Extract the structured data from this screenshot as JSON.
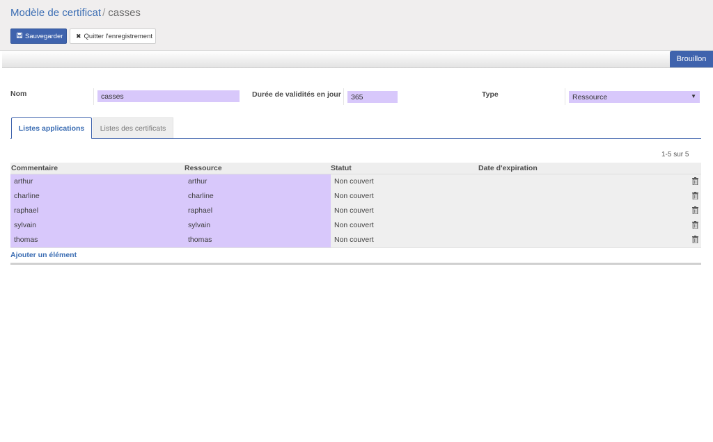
{
  "breadcrumb": {
    "parent": "Modèle de certificat",
    "separator": "/",
    "current": "casses"
  },
  "toolbar": {
    "save_label": "Sauvegarder",
    "discard_label": "Quitter l'enregistrement"
  },
  "status": {
    "label": "Brouillon"
  },
  "form": {
    "name_label": "Nom",
    "name_value": "casses",
    "validity_label": "Durée de validités en jour",
    "validity_value": "365",
    "type_label": "Type",
    "type_value": "Ressource"
  },
  "tabs": [
    {
      "label": "Listes applications",
      "active": true
    },
    {
      "label": "Listes des certificats",
      "active": false
    }
  ],
  "pager": {
    "text": "1-5 sur 5"
  },
  "table": {
    "columns": [
      "Commentaire",
      "Ressource",
      "Statut",
      "Date d'expiration"
    ],
    "rows": [
      {
        "commentaire": "arthur",
        "ressource": "arthur",
        "statut": "Non couvert",
        "date": ""
      },
      {
        "commentaire": "charline",
        "ressource": "charline",
        "statut": "Non couvert",
        "date": ""
      },
      {
        "commentaire": "raphael",
        "ressource": "raphael",
        "statut": "Non couvert",
        "date": ""
      },
      {
        "commentaire": "sylvain",
        "ressource": "sylvain",
        "statut": "Non couvert",
        "date": ""
      },
      {
        "commentaire": "thomas",
        "ressource": "thomas",
        "statut": "Non couvert",
        "date": ""
      }
    ],
    "add_line_label": "Ajouter un élément"
  },
  "icons": {
    "save": "floppy-icon",
    "discard": "close-icon",
    "delete": "trash-icon",
    "dropdown": "caret-down-icon"
  },
  "colors": {
    "primary": "#3f63ad",
    "required_field": "#d8c8fb",
    "link": "#3b6db3"
  }
}
